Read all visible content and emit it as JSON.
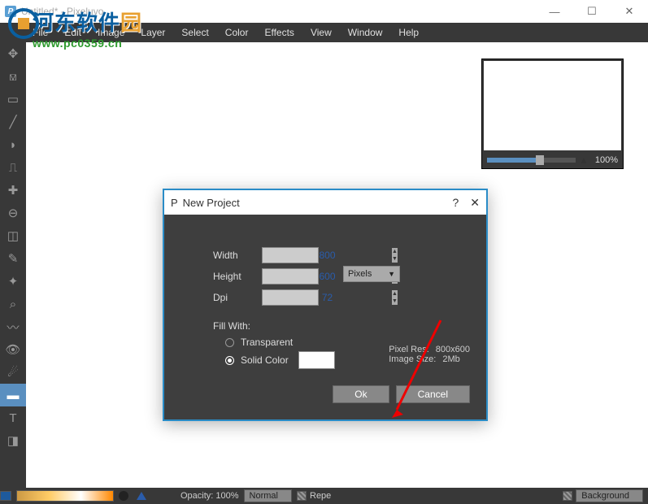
{
  "window": {
    "title": "Untitled* - Pixeluvo"
  },
  "menu": [
    "File",
    "Edit",
    "Image",
    "Layer",
    "Select",
    "Color",
    "Effects",
    "View",
    "Window",
    "Help"
  ],
  "navigator": {
    "zoom": "100%"
  },
  "dialog": {
    "title": "New Project",
    "width_label": "Width",
    "width_value": "800",
    "height_label": "Height",
    "height_value": "600",
    "dpi_label": "Dpi",
    "dpi_value": "72",
    "units_selected": "Pixels",
    "fill_label": "Fill With:",
    "opt_transparent": "Transparent",
    "opt_solid": "Solid Color",
    "info_res_label": "Pixel Res:",
    "info_res_value": "800x600",
    "info_size_label": "Image Size:",
    "info_size_value": "2Mb",
    "ok": "Ok",
    "cancel": "Cancel"
  },
  "status": {
    "opacity": "Opacity: 100%",
    "blend_mode": "Normal",
    "repeat": "Repe",
    "layer": "Background"
  },
  "watermark": {
    "text_part1": "河东软件",
    "text_part2": "园",
    "url": "www.pc0359.cn"
  }
}
